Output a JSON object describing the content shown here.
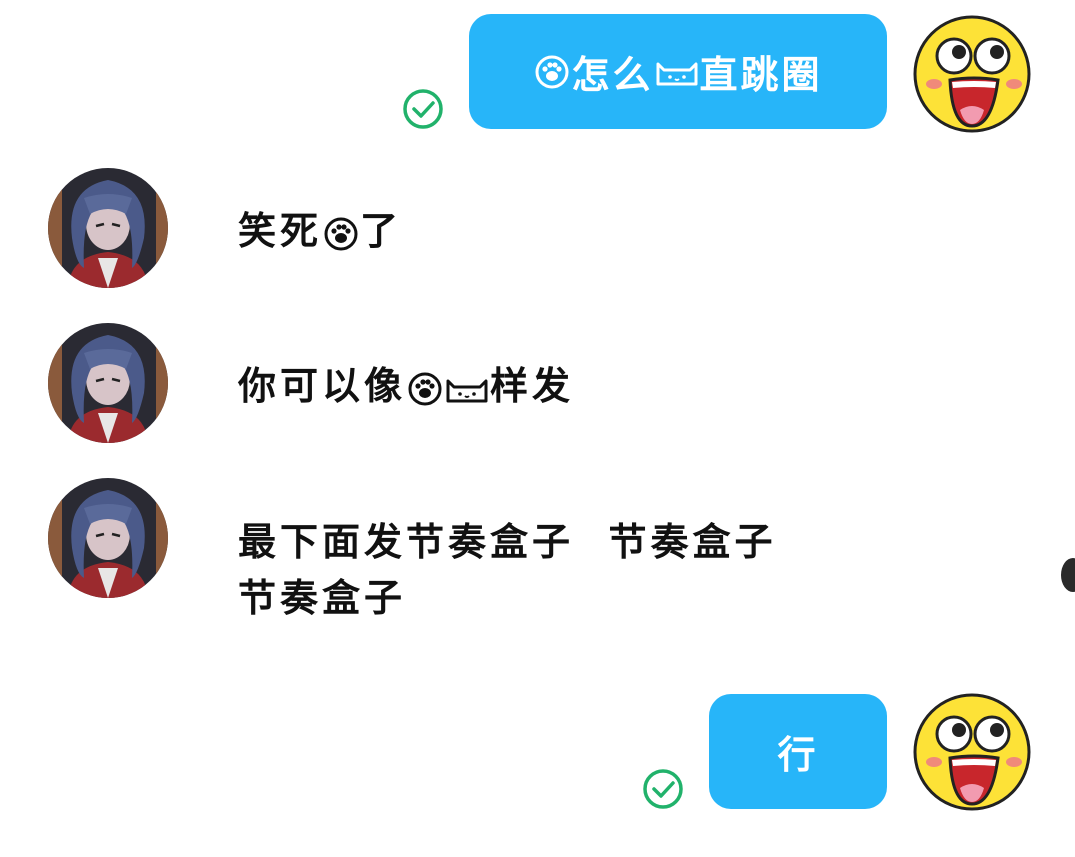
{
  "messages": [
    {
      "direction": "out",
      "text_before": "",
      "text_emoji": "",
      "text": "怎么",
      "text_after": "直跳圈",
      "status": "sent"
    },
    {
      "direction": "in",
      "text": "笑死",
      "text_after": "了"
    },
    {
      "direction": "in",
      "text": "你可以像",
      "text_after": "样发"
    },
    {
      "direction": "in",
      "line1": "最下面发节奏盒子  节奏盒子",
      "line2": "节奏盒子"
    },
    {
      "direction": "out",
      "text": "行",
      "status": "sent"
    }
  ],
  "colors": {
    "bubble_out": "#27b5f9",
    "text_in": "#111111",
    "check": "#21b26b"
  },
  "icons": {
    "paw": "paw-emoji-icon",
    "cat": "cat-face-emoji-icon",
    "check": "check-circle-icon",
    "avatar_self": "laughing-face-avatar",
    "avatar_other": "anime-character-avatar"
  }
}
